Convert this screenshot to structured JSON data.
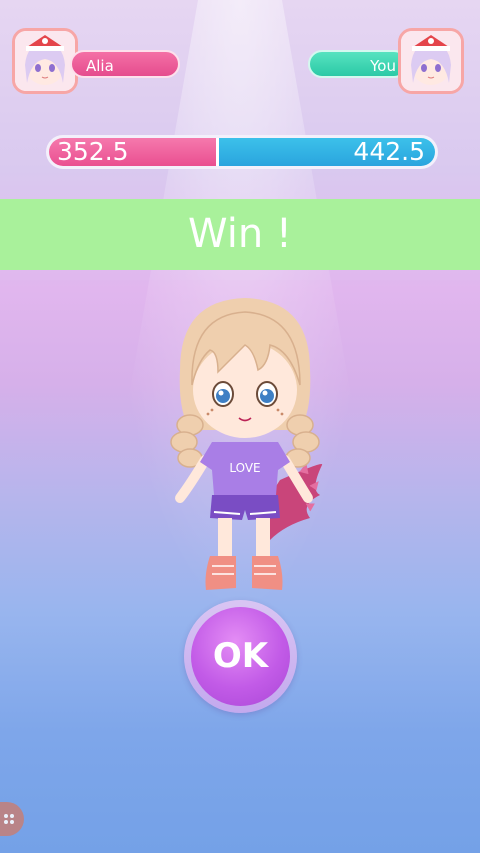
{
  "players": {
    "opponent": {
      "name": "Alia",
      "avatar_icon": "opponent-avatar",
      "color": "#e94f90"
    },
    "player": {
      "name": "You",
      "avatar_icon": "player-avatar",
      "color": "#2fcaa8"
    }
  },
  "scores": {
    "opponent": "352.5",
    "player": "442.5",
    "opponent_share": 0.44
  },
  "result": {
    "text": "Win !"
  },
  "character": {
    "shirt_text": "LOVE"
  },
  "ok_button": {
    "label": "OK"
  },
  "corner_icon": "settings-badge-icon"
}
